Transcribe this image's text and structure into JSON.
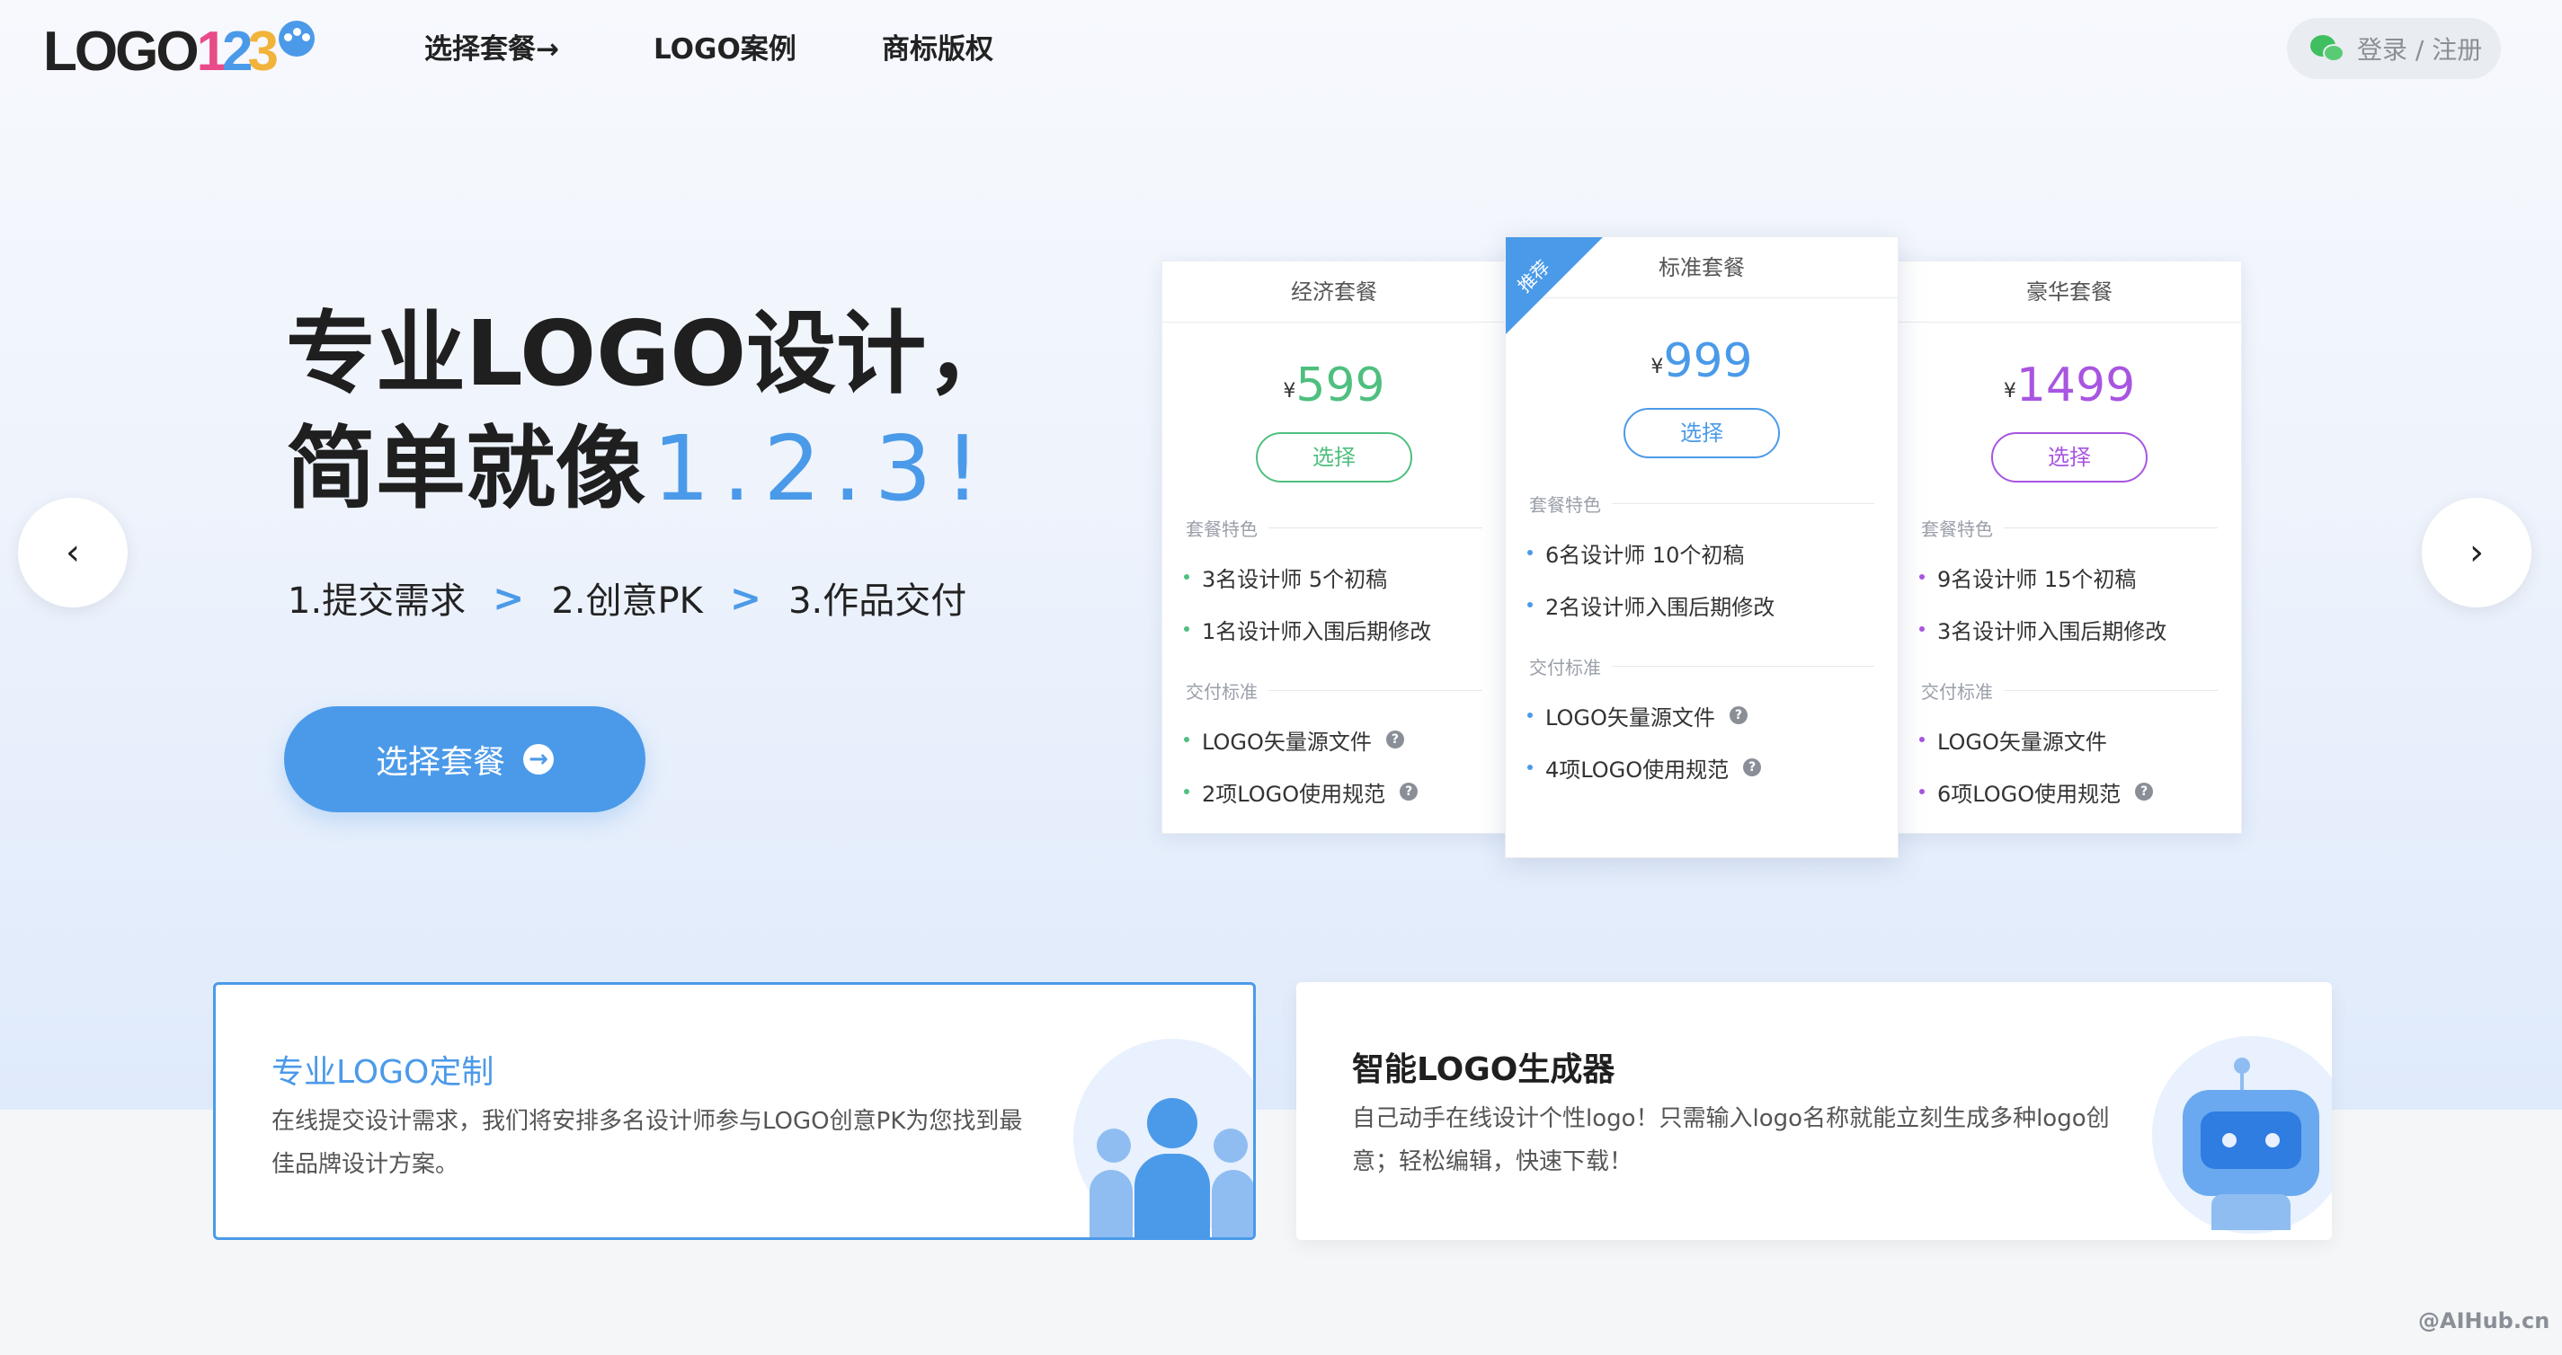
{
  "logo": {
    "text": "LOGO",
    "num1": "1",
    "num2": "2",
    "num3": "3"
  },
  "nav": {
    "items": [
      "选择套餐→",
      "LOGO案例",
      "商标版权"
    ]
  },
  "login": {
    "label": "登录 / 注册"
  },
  "hero": {
    "title_line1": "专业LOGO设计，",
    "title_line2": "简单就像",
    "title_highlight": "1.2.3!",
    "steps": [
      "1.提交需求",
      "2.创意PK",
      "3.作品交付"
    ],
    "cta_label": "选择套餐",
    "accent_color": "#4b9ae9"
  },
  "plans": {
    "currency": "¥",
    "select_label": "选择",
    "features_heading": "套餐特色",
    "delivery_heading": "交付标准",
    "ribbon": "推荐",
    "items": [
      {
        "name": "经济套餐",
        "price": "599",
        "color": "#4fbf7f",
        "features": [
          "3名设计师 5个初稿",
          "1名设计师入围后期修改"
        ],
        "delivery": [
          "LOGO矢量源文件",
          "2项LOGO使用规范"
        ]
      },
      {
        "name": "标准套餐",
        "price": "999",
        "color": "#4b9ae9",
        "features": [
          "6名设计师 10个初稿",
          "2名设计师入围后期修改"
        ],
        "delivery": [
          "LOGO矢量源文件",
          "4项LOGO使用规范"
        ]
      },
      {
        "name": "豪华套餐",
        "price": "1499",
        "color": "#a855e0",
        "features": [
          "9名设计师 15个初稿",
          "3名设计师入围后期修改"
        ],
        "delivery": [
          "LOGO矢量源文件",
          "6项LOGO使用规范"
        ]
      }
    ]
  },
  "services": [
    {
      "title": "专业LOGO定制",
      "desc": "在线提交设计需求，我们将安排多名设计师参与LOGO创意PK为您找到最佳品牌设计方案。"
    },
    {
      "title": "智能LOGO生成器",
      "desc": "自己动手在线设计个性logo！只需输入logo名称就能立刻生成多种logo创意；轻松编辑，快速下载！"
    }
  ],
  "watermark": "@AIHub.cn"
}
